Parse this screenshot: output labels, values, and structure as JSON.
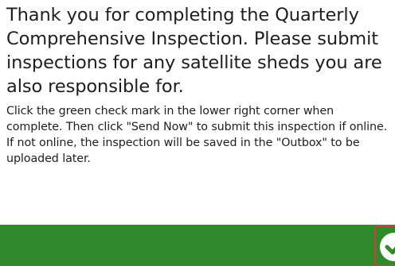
{
  "main": {
    "heading": "Thank you for completing the Quarterly Comprehensive Inspection. Please submit inspections for any satellite sheds you are also responsible for.",
    "instructions": "Click the green check mark in the lower right corner when complete. Then click \"Send Now\" to submit this inspection if online. If not online, the inspection will be saved in the \"Outbox\" to be uploaded later."
  },
  "footer": {
    "submit_icon": "check-circle-icon",
    "bar_color": "#2f8a2a",
    "highlight_color": "#d23b3b"
  }
}
